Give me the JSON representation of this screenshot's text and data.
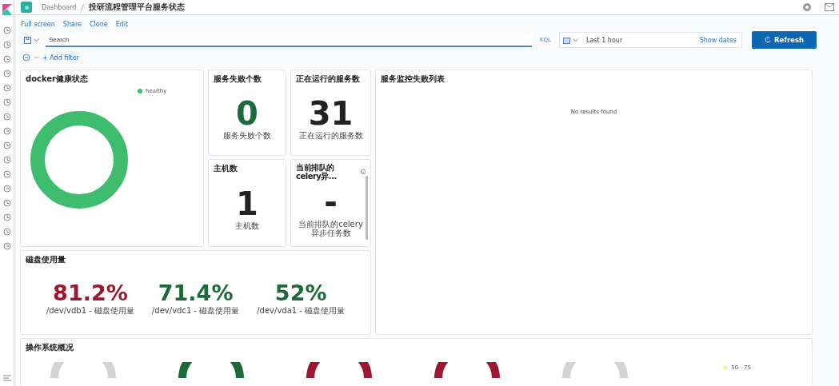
{
  "breadcrumbs": [
    "Dashboard",
    "投研流程管理平台服务状态"
  ],
  "top_menu": [
    "Full screen",
    "Share",
    "Clone",
    "Edit"
  ],
  "query_bar": {
    "placeholder": "Search",
    "language": "KQL",
    "time_range": "Last 1 hour",
    "show_dates": "Show dates",
    "refresh": "Refresh"
  },
  "filter": {
    "add_label": "+ Add filter"
  },
  "docker_panel": {
    "title": "docker健康状态",
    "legend": [
      {
        "label": "healthy",
        "color": "#3ebd6e"
      }
    ]
  },
  "metric_panels": [
    {
      "title": "服务失败个数",
      "value": "0",
      "label": "服务失败个数",
      "color": "#1b6b3a"
    },
    {
      "title": "正在运行的服务数",
      "value": "31",
      "label": "正在运行的服务数",
      "color": "#222222"
    },
    {
      "title": "主机数",
      "value": "1",
      "label": "主机数",
      "color": "#222222"
    },
    {
      "title": "当前排队的celery异...",
      "value": "-",
      "label": "当前排队的celery异步任务数",
      "color": "#222222"
    }
  ],
  "failure_panel": {
    "title": "服务监控失败列表",
    "empty": "No results found"
  },
  "disk_panel": {
    "title": "磁盘使用量",
    "metrics": [
      {
        "value": "81.2%",
        "label": "/dev/vdb1 - 磁盘使用量",
        "color": "#9c1832"
      },
      {
        "value": "71.4%",
        "label": "/dev/vdc1 - 磁盘使用量",
        "color": "#1b6b3a"
      },
      {
        "value": "52%",
        "label": "/dev/vda1 - 磁盘使用量",
        "color": "#1b6b3a"
      }
    ]
  },
  "os_panel": {
    "title": "操作系统概况",
    "gauges": [
      {
        "color": "#d3d3d3"
      },
      {
        "color": "#1b6b3a"
      },
      {
        "color": "#9c1832"
      },
      {
        "color": "#9c1832"
      },
      {
        "color": "#d3d3d3"
      }
    ],
    "legend": [
      {
        "label": "50 - 75",
        "color": "#f2f0a8"
      }
    ]
  }
}
